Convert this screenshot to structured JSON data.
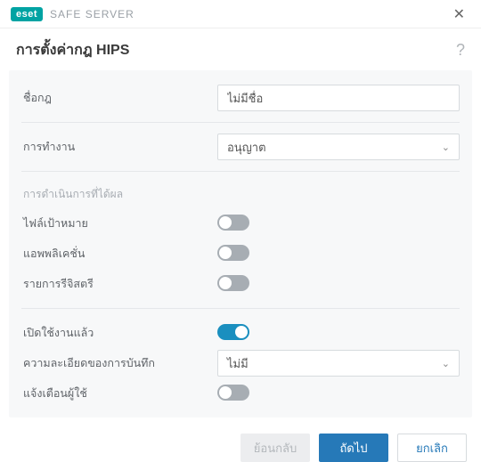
{
  "titlebar": {
    "logo": "eset",
    "product": "SAFE SERVER"
  },
  "header": {
    "title": "การตั้งค่ากฎ HIPS"
  },
  "fields": {
    "ruleName": {
      "label": "ชื่อกฎ",
      "value": "ไม่มีชื่อ"
    },
    "action": {
      "label": "การทำงาน",
      "value": "อนุญาต"
    }
  },
  "affectedSection": {
    "title": "การดำเนินการที่ได้ผล",
    "targetFiles": {
      "label": "ไฟล์เป้าหมาย",
      "on": false
    },
    "applications": {
      "label": "แอพพลิเคชั่น",
      "on": false
    },
    "registry": {
      "label": "รายการรีจิสตรี",
      "on": false
    }
  },
  "extra": {
    "enabled": {
      "label": "เปิดใช้งานแล้ว",
      "on": true
    },
    "logDetail": {
      "label": "ความละเอียดของการบันทึก",
      "value": "ไม่มี"
    },
    "notify": {
      "label": "แจ้งเตือนผู้ใช้",
      "on": false
    }
  },
  "footer": {
    "back": "ย้อนกลับ",
    "next": "ถัดไป",
    "cancel": "ยกเลิก"
  }
}
